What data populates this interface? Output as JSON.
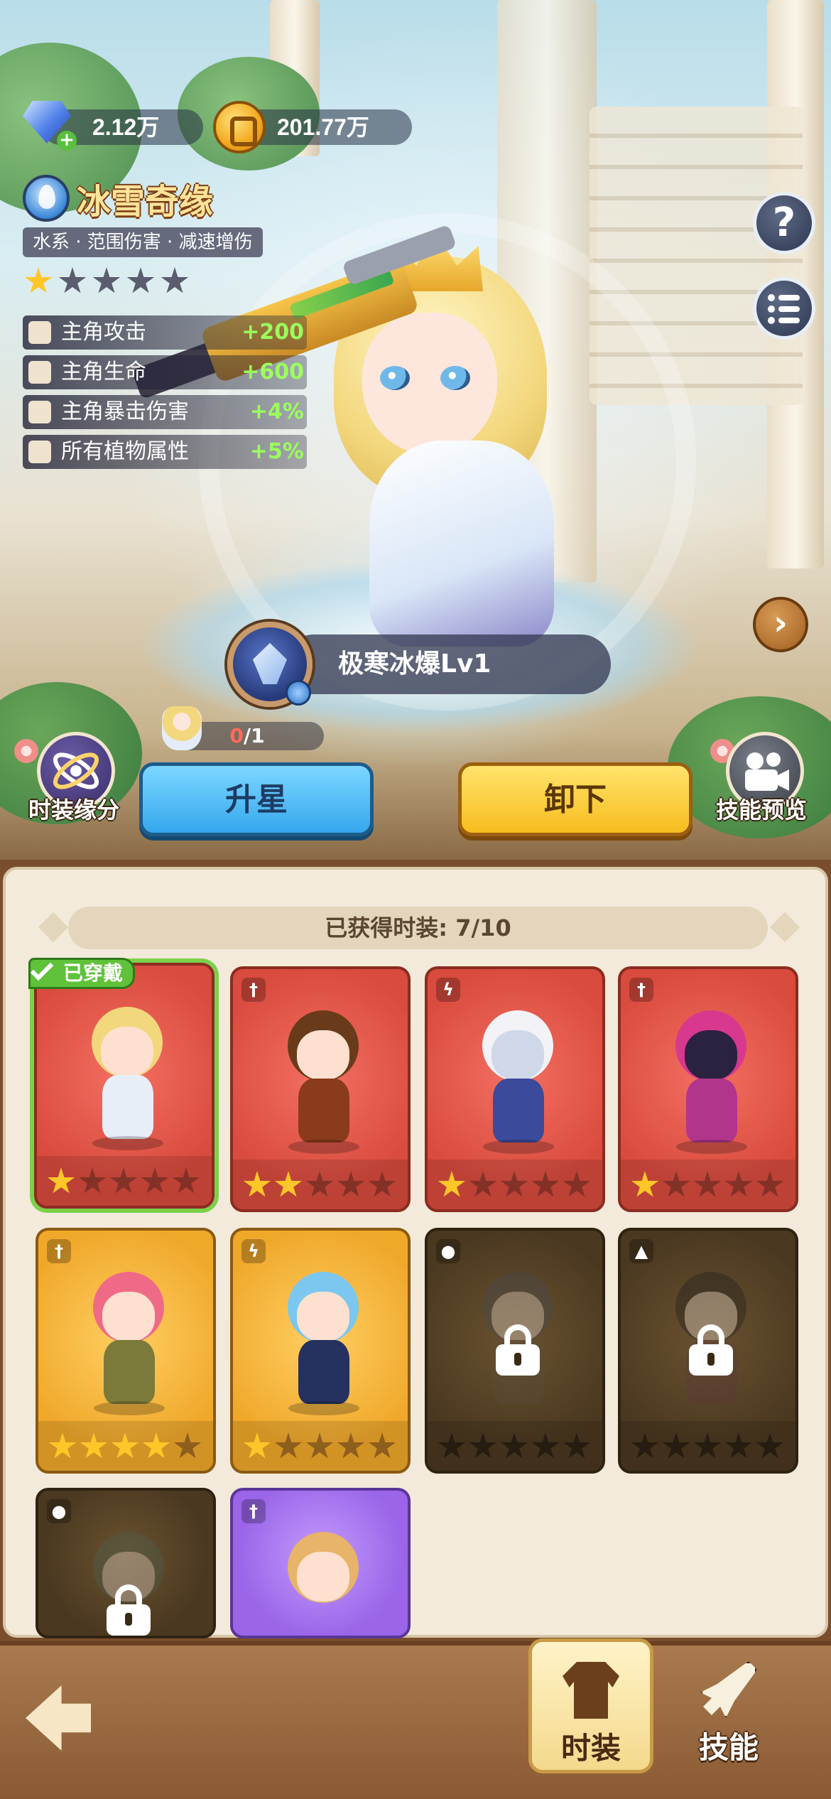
{
  "currency": {
    "gems": "2.12万",
    "coins": "201.77万"
  },
  "costume": {
    "name": "冰雪奇缘",
    "element_icon": "water-drop-icon",
    "tagline": "水系 · 范围伤害 · 减速增伤",
    "star_level": 1,
    "max_stars": 5,
    "bonuses": [
      {
        "label": "主角攻击",
        "value": "+200"
      },
      {
        "label": "主角生命",
        "value": "+600"
      },
      {
        "label": "主角暴击伤害",
        "value": "+4%"
      },
      {
        "label": "所有植物属性",
        "value": "+5%"
      }
    ]
  },
  "skill": {
    "name": "极寒冰爆Lv1"
  },
  "fragments": {
    "current": "0",
    "total": "/1"
  },
  "side_buttons": {
    "left_label": "时装缘分",
    "right_label": "技能预览",
    "help": "?"
  },
  "actions": {
    "upgrade_label": "升星",
    "unequip_label": "卸下"
  },
  "collection": {
    "header": "已获得时装: 7/10",
    "equipped_tag": "已穿戴",
    "cards": [
      {
        "color": "red",
        "element": "water",
        "stars": 1,
        "locked": false,
        "equipped": true
      },
      {
        "color": "red",
        "element": "sword",
        "stars": 2,
        "locked": false,
        "equipped": false
      },
      {
        "color": "red",
        "element": "lightning",
        "stars": 1,
        "locked": false,
        "equipped": false
      },
      {
        "color": "red",
        "element": "sword",
        "stars": 1,
        "locked": false,
        "equipped": false
      },
      {
        "color": "gold",
        "element": "sword",
        "stars": 4,
        "locked": false,
        "equipped": false
      },
      {
        "color": "gold",
        "element": "lightning",
        "stars": 1,
        "locked": false,
        "equipped": false
      },
      {
        "color": "locked",
        "element": "water",
        "stars": 0,
        "locked": true,
        "equipped": false
      },
      {
        "color": "locked",
        "element": "fire",
        "stars": 0,
        "locked": true,
        "equipped": false
      },
      {
        "color": "locked",
        "element": "poison",
        "stars": 0,
        "locked": true,
        "equipped": false
      },
      {
        "color": "purple",
        "element": "sword",
        "stars": 0,
        "locked": false,
        "equipped": false
      }
    ]
  },
  "nav": {
    "tab_costume": "时装",
    "tab_skill": "技能"
  },
  "colors": {
    "accent_yellow": "#f7bd1f",
    "accent_blue": "#35a7ee",
    "bonus_green": "#9aff5c",
    "equipped_green": "#5fc23a"
  }
}
